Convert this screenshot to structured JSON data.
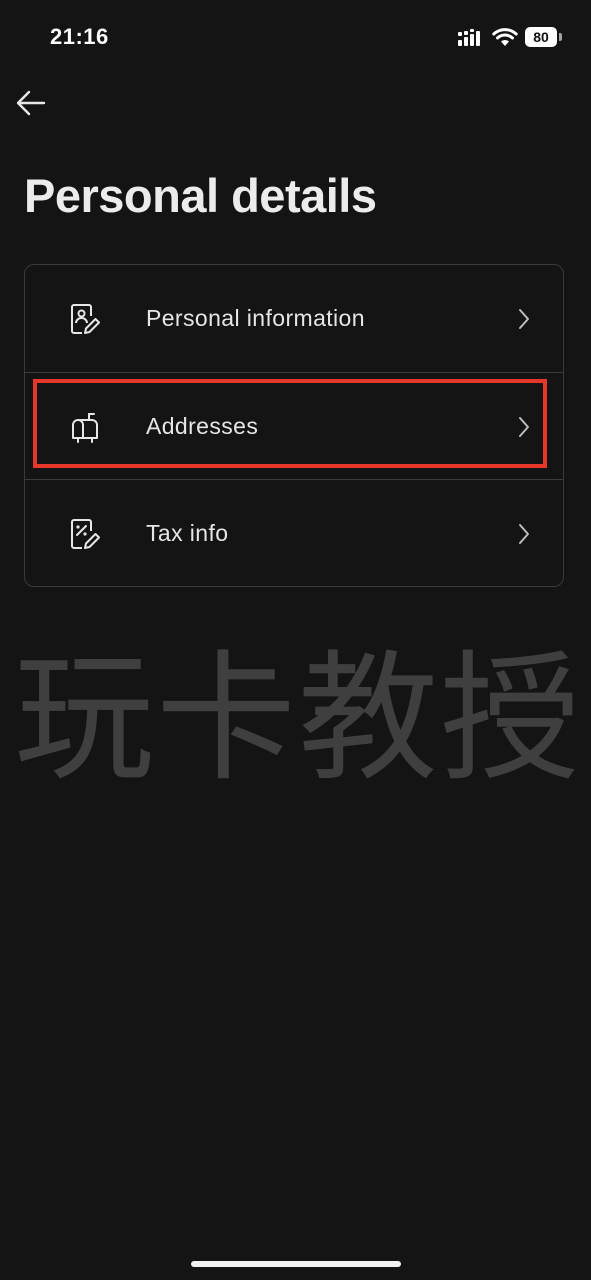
{
  "status_bar": {
    "time": "21:16",
    "battery": "80",
    "icons": [
      "signal-icon",
      "wifi-icon",
      "battery-icon"
    ]
  },
  "header": {
    "back_icon": "back-arrow-icon",
    "title": "Personal details"
  },
  "menu": {
    "items": [
      {
        "label": "Personal information",
        "icon": "id-card-edit-icon",
        "highlighted": false
      },
      {
        "label": "Addresses",
        "icon": "mailbox-icon",
        "highlighted": true
      },
      {
        "label": "Tax info",
        "icon": "tax-document-edit-icon",
        "highlighted": false
      }
    ]
  },
  "watermark": "玩卡教授",
  "colors": {
    "background": "#141414",
    "card_border": "#3a3a3a",
    "highlight": "#e5372a",
    "text": "#e6e6e6"
  }
}
